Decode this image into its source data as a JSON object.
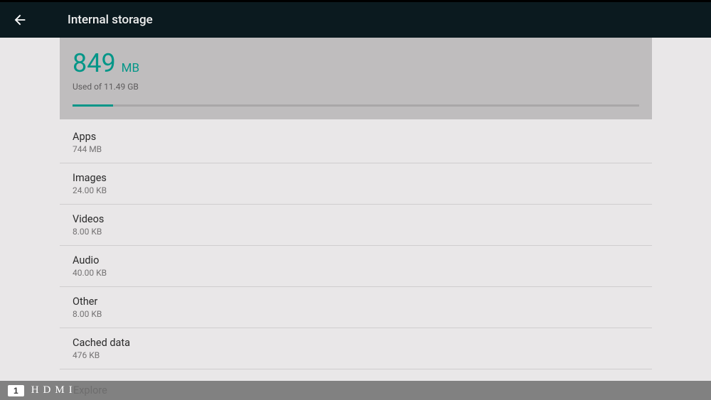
{
  "header": {
    "title": "Internal storage"
  },
  "summary": {
    "used_value": "849",
    "used_unit": "MB",
    "subtitle": "Used of 11.49 GB",
    "progress_percent": 7.2
  },
  "categories": [
    {
      "label": "Apps",
      "value": "744 MB"
    },
    {
      "label": "Images",
      "value": "24.00 KB"
    },
    {
      "label": "Videos",
      "value": "8.00 KB"
    },
    {
      "label": "Audio",
      "value": "40.00 KB"
    },
    {
      "label": "Other",
      "value": "8.00 KB"
    },
    {
      "label": "Cached data",
      "value": "476 KB"
    }
  ],
  "partial_row": {
    "label": "Explore"
  },
  "overlay": {
    "badge": "1",
    "label": "HDMI"
  }
}
